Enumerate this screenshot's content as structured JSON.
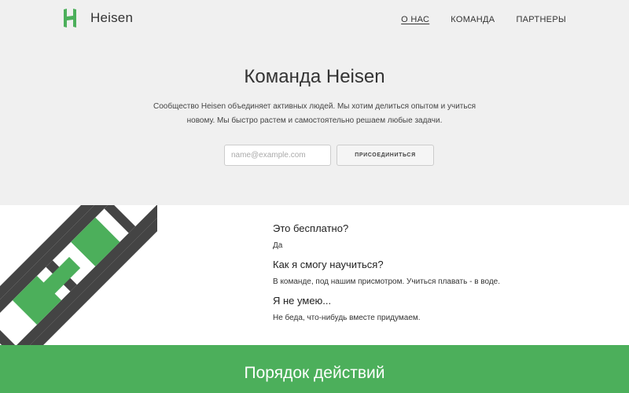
{
  "brand": {
    "name": "Heisen",
    "logo_icon": "h-logo-icon",
    "accent_color": "#4caf5b"
  },
  "nav": {
    "items": [
      {
        "label": "О НАС",
        "active": true
      },
      {
        "label": "КОМАНДА",
        "active": false
      },
      {
        "label": "ПАРТНЕРЫ",
        "active": false
      }
    ]
  },
  "hero": {
    "title": "Команда Heisen",
    "description_line1": "Сообщество Heisen объединяет активных людей. Мы хотим делиться опытом и учиться",
    "description_line2": "новому. Мы быстро растем и самостоятельно решаем любые задачи.",
    "email_placeholder": "name@example.com",
    "email_value": "",
    "join_label": "ПРИСОЕДИНИТЬСЯ"
  },
  "faq": [
    {
      "question": "Это бесплатно?",
      "answer": "Да"
    },
    {
      "question": "Как я смогу научиться?",
      "answer": "В команде, под нашим присмотром. Учиться плавать - в воде."
    },
    {
      "question": "Я не умею...",
      "answer": "Не беда, что-нибудь вместе придумаем."
    }
  ],
  "steps": {
    "title": "Порядок действий"
  }
}
